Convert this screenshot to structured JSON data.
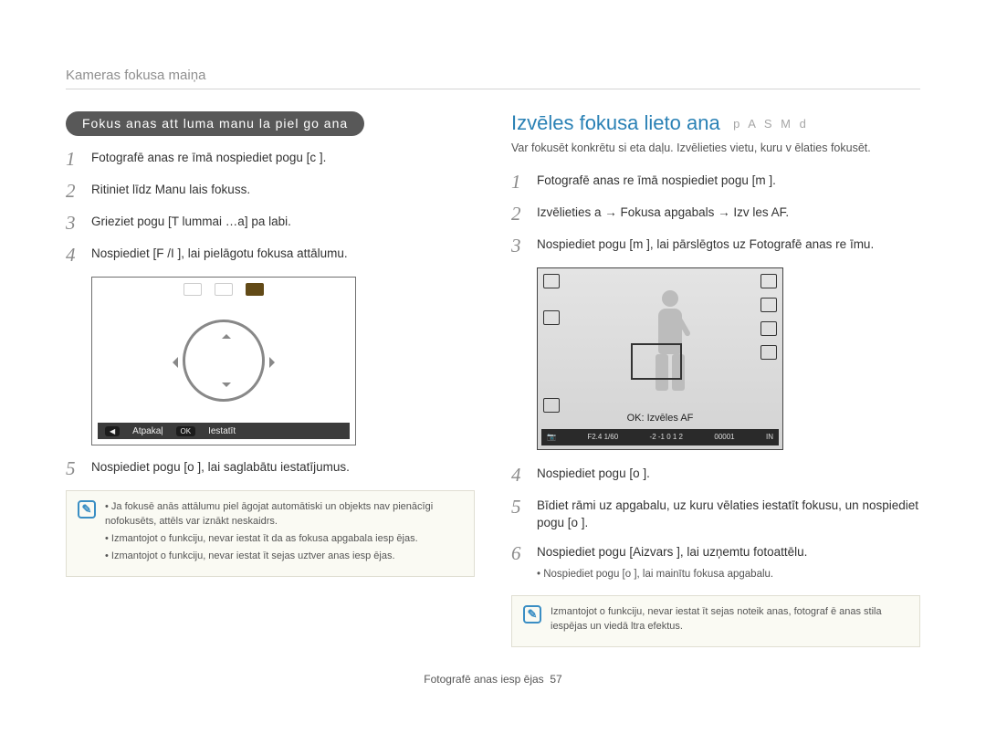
{
  "breadcrumb": "Kameras fokusa maiņa",
  "left": {
    "pill": "Fokus  anas att  luma manu  la piel  go ana",
    "steps": [
      "Fotografē anas re  īmā nospiediet pogu [c  ].",
      "Ritiniet līdz Manu  lais fokuss.",
      "Grieziet pogu [T  lummai  …a] pa labi.",
      "Nospiediet [F /I       ], lai pielāgotu fokusa attālumu.",
      "Nospiediet pogu [o ], lai saglabātu iestatījumus."
    ],
    "lcd": {
      "back": "Atpakaļ",
      "set": "Iestatīt"
    },
    "note": [
      "Ja fokusē anās attālumu piel āgojat automātiski un objekts nav pienācīgi nofokusēts, attēls var iznākt neskaidrs.",
      "Izmantojot  o funkciju, nevar iestat īt da as fokusa apgabala iesp ējas.",
      "Izmantojot  o funkciju, nevar iestat īt sejas uztver anas iesp ējas."
    ]
  },
  "right": {
    "heading": "Izvēles fokusa lieto ana",
    "modes": "p A S M d",
    "desc": "Var fokusēt konkrētu si eta daļu. Izvēlieties vietu, kuru v ēlaties fokusēt.",
    "steps": [
      "Fotografē anas re  īmā nospiediet pogu [m       ].",
      "Izvēlieties a     → Fokusa apgabals → Izv  les AF.",
      "Nospiediet pogu [m       ], lai pārslēgtos uz Fotografē anas re īmu.",
      "Nospiediet pogu [o ].",
      "Bīdiet rāmi uz apgabalu, uz kuru vēlaties iestatīt fokusu, un nospiediet pogu [o ].",
      "Nospiediet pogu [Aizvars ], lai uzņemtu fotoattēlu."
    ],
    "sub6": "Nospiediet pogu [o ], lai mainītu fokusa apgabalu.",
    "lcd": {
      "ok": "OK: Izvēles AF",
      "info_left": "F2.4  1/60",
      "info_mid": "-2 -1 0 1 2",
      "info_right": "00001",
      "info_in": "IN"
    },
    "note": "Izmantojot  o funkciju, nevar iestat īt sejas noteik anas, fotograf ē anas stila iespējas un viedā  ltra efektus."
  },
  "footer": {
    "label": "Fotografē anas iesp ējas",
    "page": "57"
  }
}
